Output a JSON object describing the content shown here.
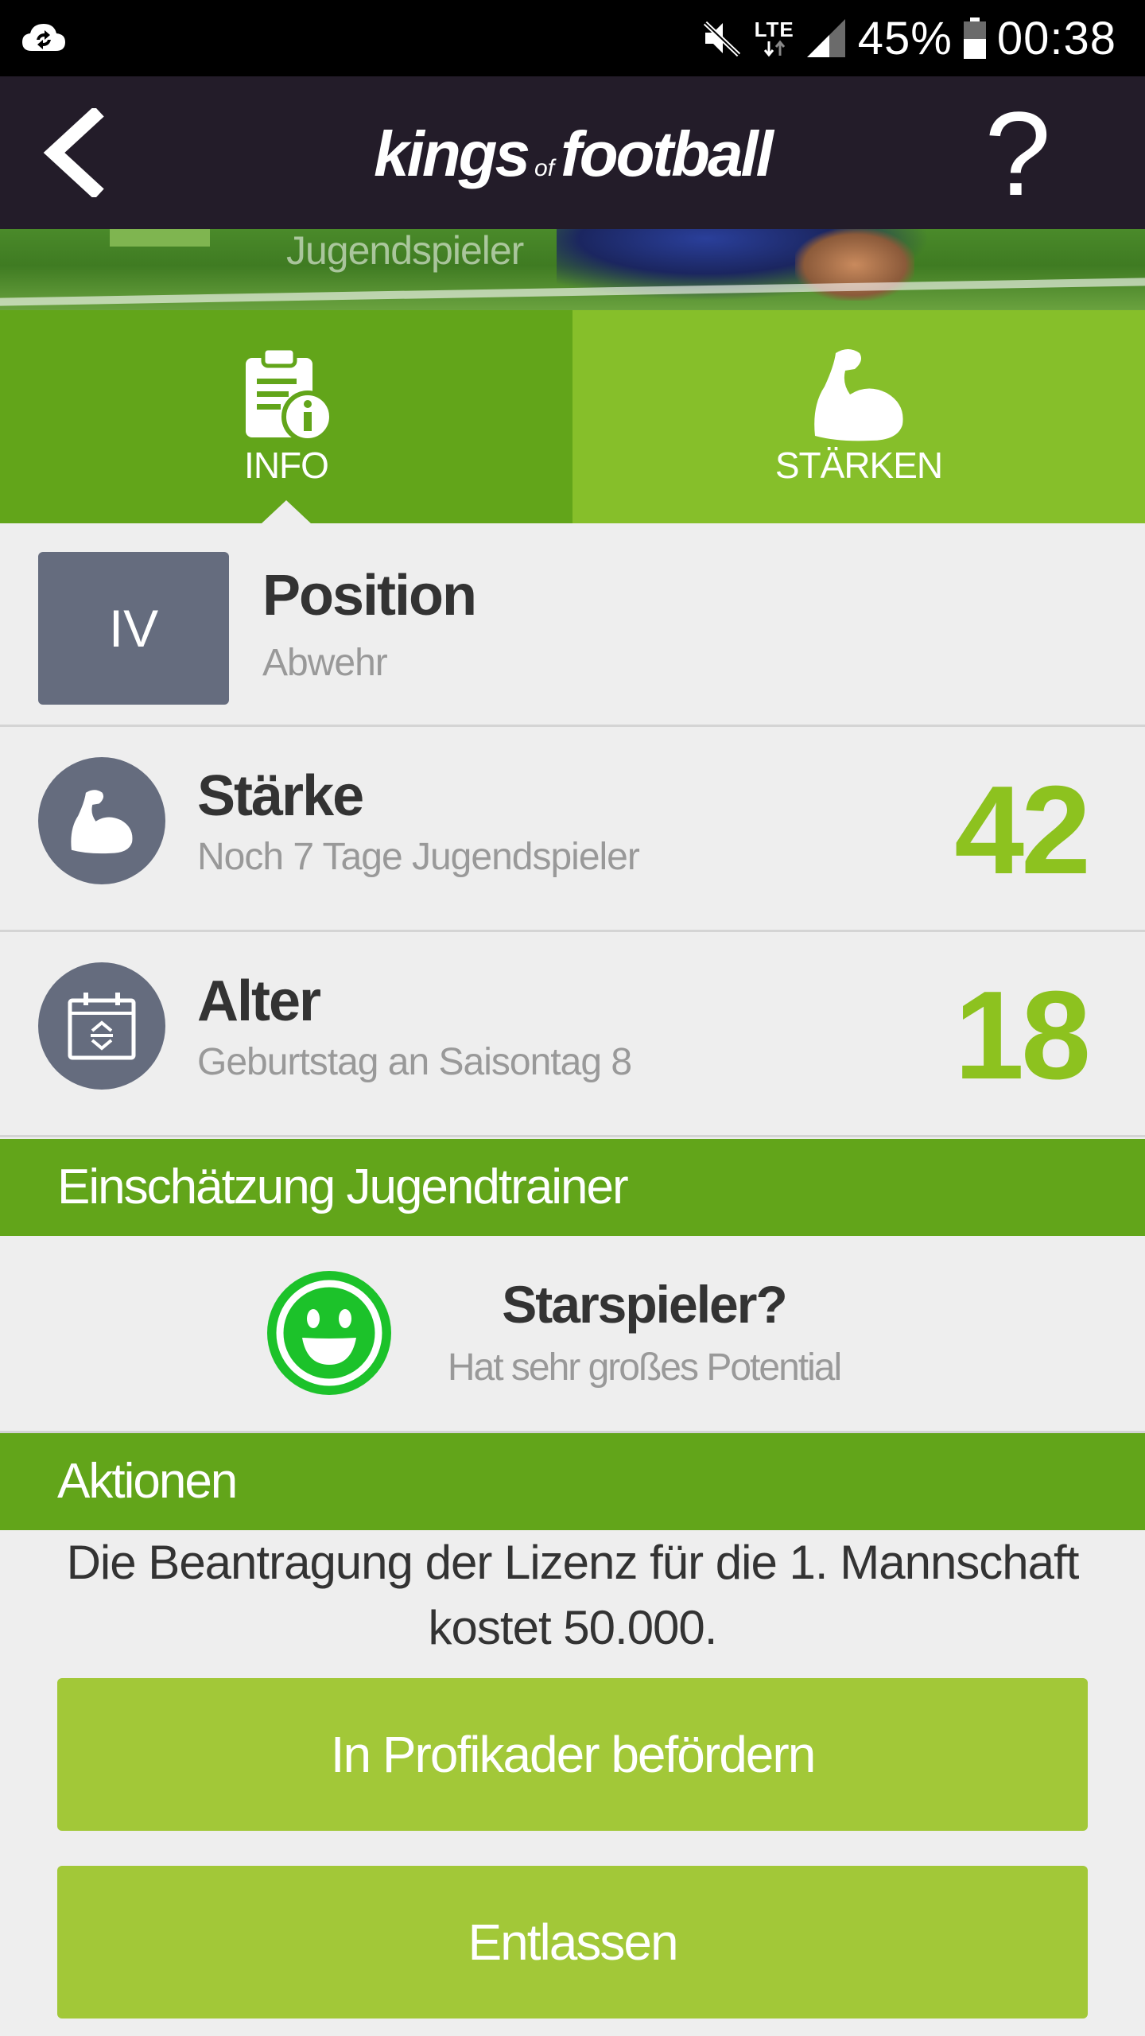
{
  "status_bar": {
    "network": "LTE",
    "battery": "45%",
    "time": "00:38"
  },
  "header": {
    "logo_left": "kings",
    "logo_mid": "of",
    "logo_right": "football",
    "help_label": "?"
  },
  "hero": {
    "label": "Jugendspieler"
  },
  "tabs": [
    {
      "label": "INFO",
      "icon": "clipboard-info-icon",
      "active": true
    },
    {
      "label": "STÄRKEN",
      "icon": "flexed-biceps-icon",
      "active": false
    }
  ],
  "position": {
    "code": "IV",
    "title": "Position",
    "subtitle": "Abwehr"
  },
  "staerke": {
    "title": "Stärke",
    "subtitle": "Noch 7 Tage Jugendspieler",
    "value": "42",
    "icon": "flexed-biceps-icon"
  },
  "alter": {
    "title": "Alter",
    "subtitle": "Geburtstag an Saisontag 8",
    "value": "18",
    "icon": "calendar-icon"
  },
  "trainer": {
    "section_title": "Einschätzung Jugendtrainer",
    "title": "Starspieler?",
    "subtitle": "Hat sehr großes Potential",
    "icon": "smiley-icon"
  },
  "actions": {
    "section_title": "Aktionen",
    "license_line1": "Die Beantragung der Lizenz für die 1. Mannschaft",
    "license_line2": "kostet 50.000.",
    "promote_label": "In Profikader befördern",
    "release_label": "Entlassen"
  },
  "colors": {
    "header_bg": "#231c29",
    "green_dark": "#62a51a",
    "green_light": "#86bf2a",
    "button_green": "#a2c838",
    "value_green": "#8dc21f",
    "slate": "#656c7e",
    "smiley_green": "#1cc22a"
  }
}
